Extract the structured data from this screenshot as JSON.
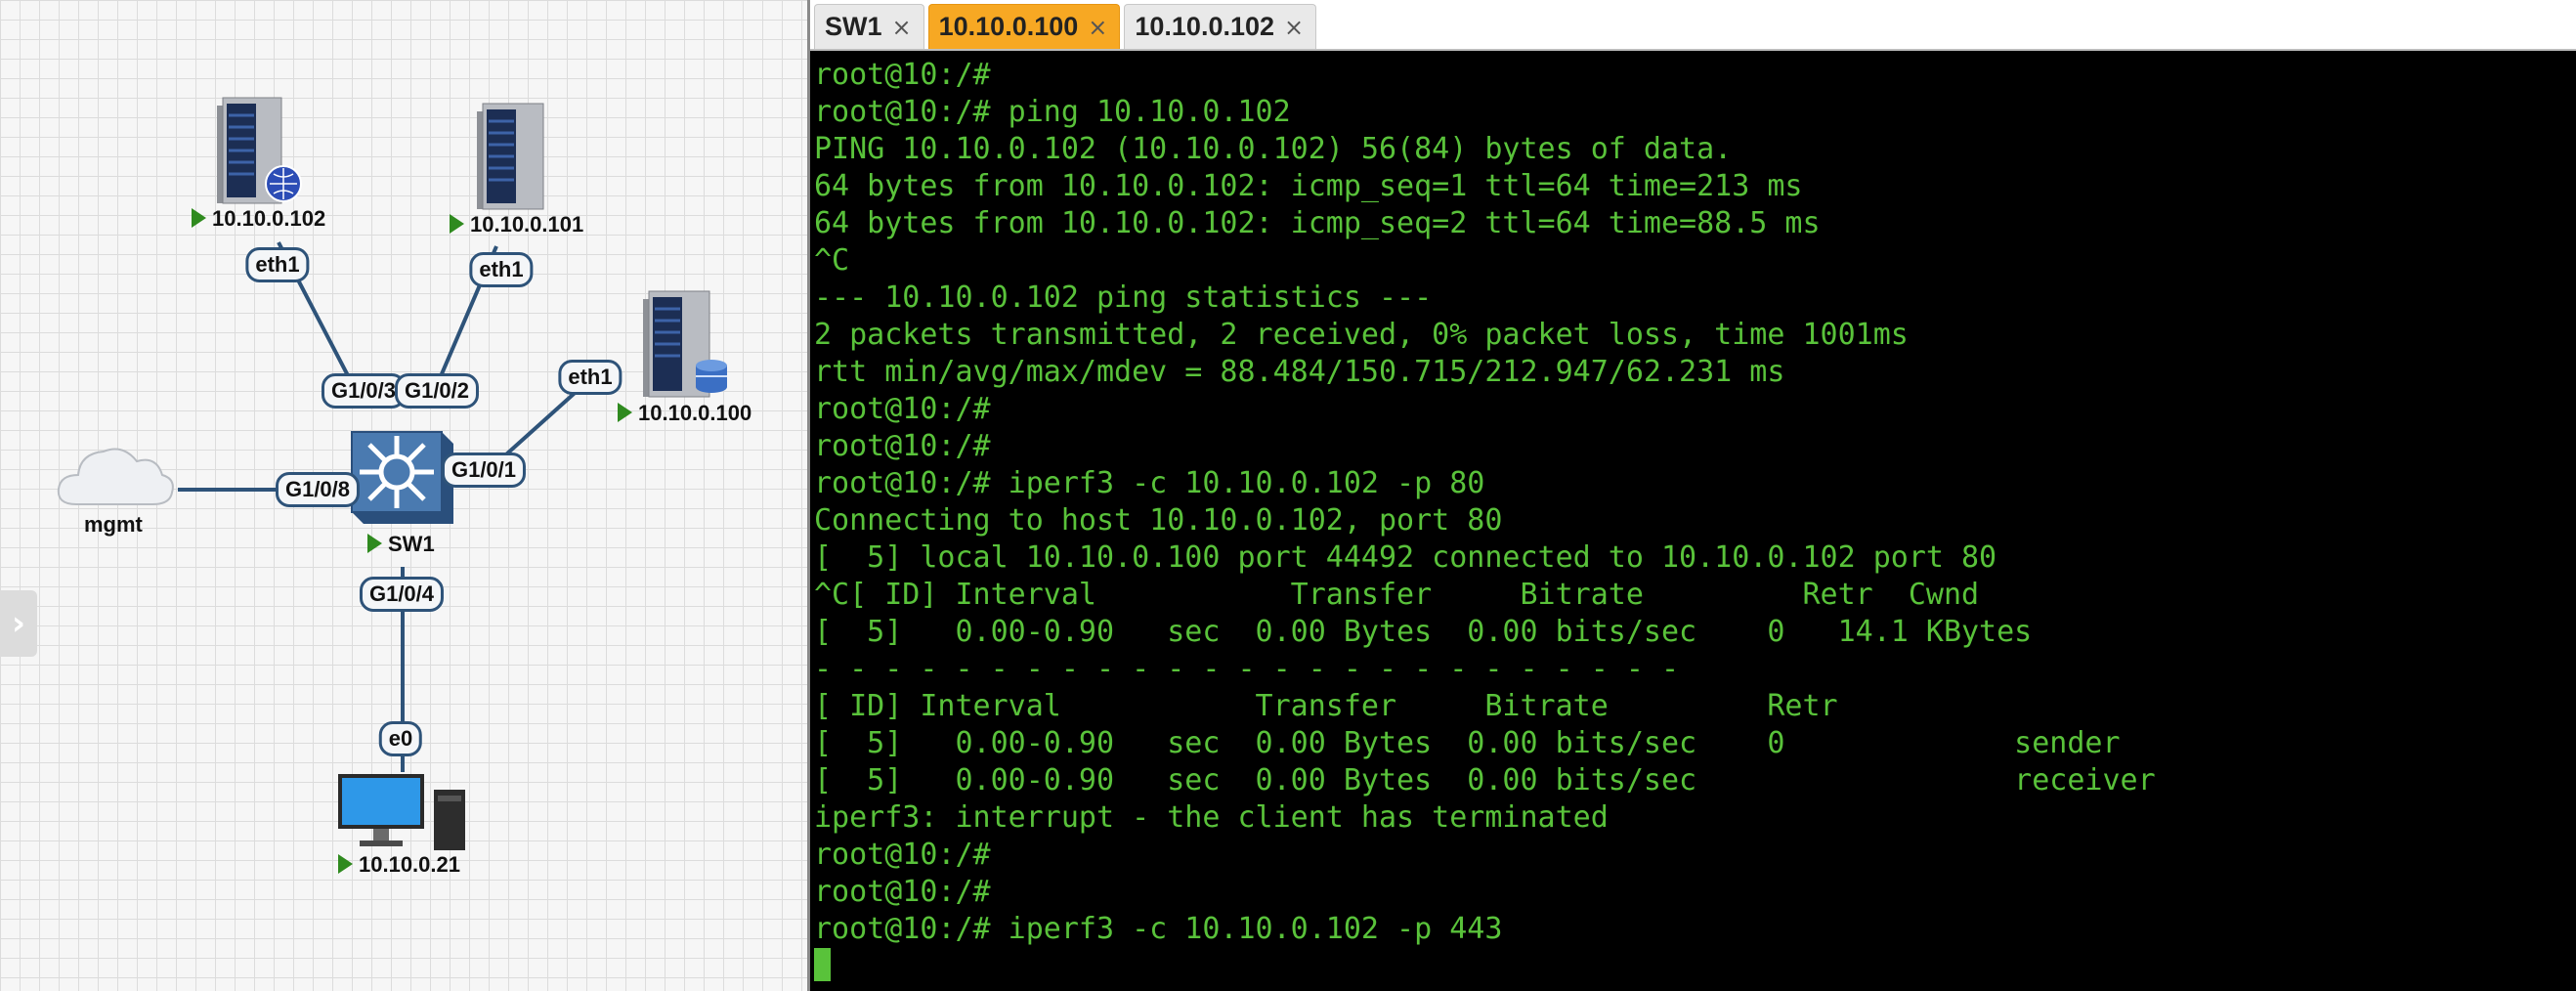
{
  "topology": {
    "nodes": {
      "srv_102": {
        "label": "10.10.0.102",
        "icon": "server-globe-icon"
      },
      "srv_101": {
        "label": "10.10.0.101",
        "icon": "server-icon"
      },
      "srv_100": {
        "label": "10.10.0.100",
        "icon": "server-database-icon"
      },
      "mgmt": {
        "label": "mgmt",
        "icon": "cloud-icon"
      },
      "sw1": {
        "label": "SW1",
        "icon": "switch-icon"
      },
      "pc": {
        "label": "10.10.0.21",
        "icon": "desktop-pc-icon"
      }
    },
    "ports": {
      "p102_eth1": "eth1",
      "p101_eth1": "eth1",
      "p100_eth1": "eth1",
      "sw_g103": "G1/0/3",
      "sw_g102": "G1/0/2",
      "sw_g101": "G1/0/1",
      "sw_g108": "G1/0/8",
      "sw_g104": "G1/0/4",
      "pc_e0": "e0"
    },
    "expand_handle": "›"
  },
  "tabs": [
    {
      "label": "SW1",
      "close": "×",
      "active": false
    },
    {
      "label": "10.10.0.100",
      "close": "×",
      "active": true
    },
    {
      "label": "10.10.0.102",
      "close": "×",
      "active": false
    }
  ],
  "terminal": {
    "lines": [
      "root@10:/#",
      "root@10:/# ping 10.10.0.102",
      "PING 10.10.0.102 (10.10.0.102) 56(84) bytes of data.",
      "64 bytes from 10.10.0.102: icmp_seq=1 ttl=64 time=213 ms",
      "64 bytes from 10.10.0.102: icmp_seq=2 ttl=64 time=88.5 ms",
      "^C",
      "--- 10.10.0.102 ping statistics ---",
      "2 packets transmitted, 2 received, 0% packet loss, time 1001ms",
      "rtt min/avg/max/mdev = 88.484/150.715/212.947/62.231 ms",
      "root@10:/#",
      "root@10:/#",
      "root@10:/# iperf3 -c 10.10.0.102 -p 80",
      "Connecting to host 10.10.0.102, port 80",
      "[  5] local 10.10.0.100 port 44492 connected to 10.10.0.102 port 80",
      "^C[ ID] Interval           Transfer     Bitrate         Retr  Cwnd",
      "[  5]   0.00-0.90   sec  0.00 Bytes  0.00 bits/sec    0   14.1 KBytes",
      "- - - - - - - - - - - - - - - - - - - - - - - - -",
      "[ ID] Interval           Transfer     Bitrate         Retr",
      "[  5]   0.00-0.90   sec  0.00 Bytes  0.00 bits/sec    0             sender",
      "[  5]   0.00-0.90   sec  0.00 Bytes  0.00 bits/sec                  receiver",
      "iperf3: interrupt - the client has terminated",
      "root@10:/#",
      "root@10:/#",
      "root@10:/# iperf3 -c 10.10.0.102 -p 443"
    ]
  },
  "colors": {
    "terminal_text": "#59c23a",
    "terminal_bg": "#000000",
    "active_tab": "#f7a823",
    "link": "#2e5379",
    "node_running": "#2f8a1f"
  }
}
